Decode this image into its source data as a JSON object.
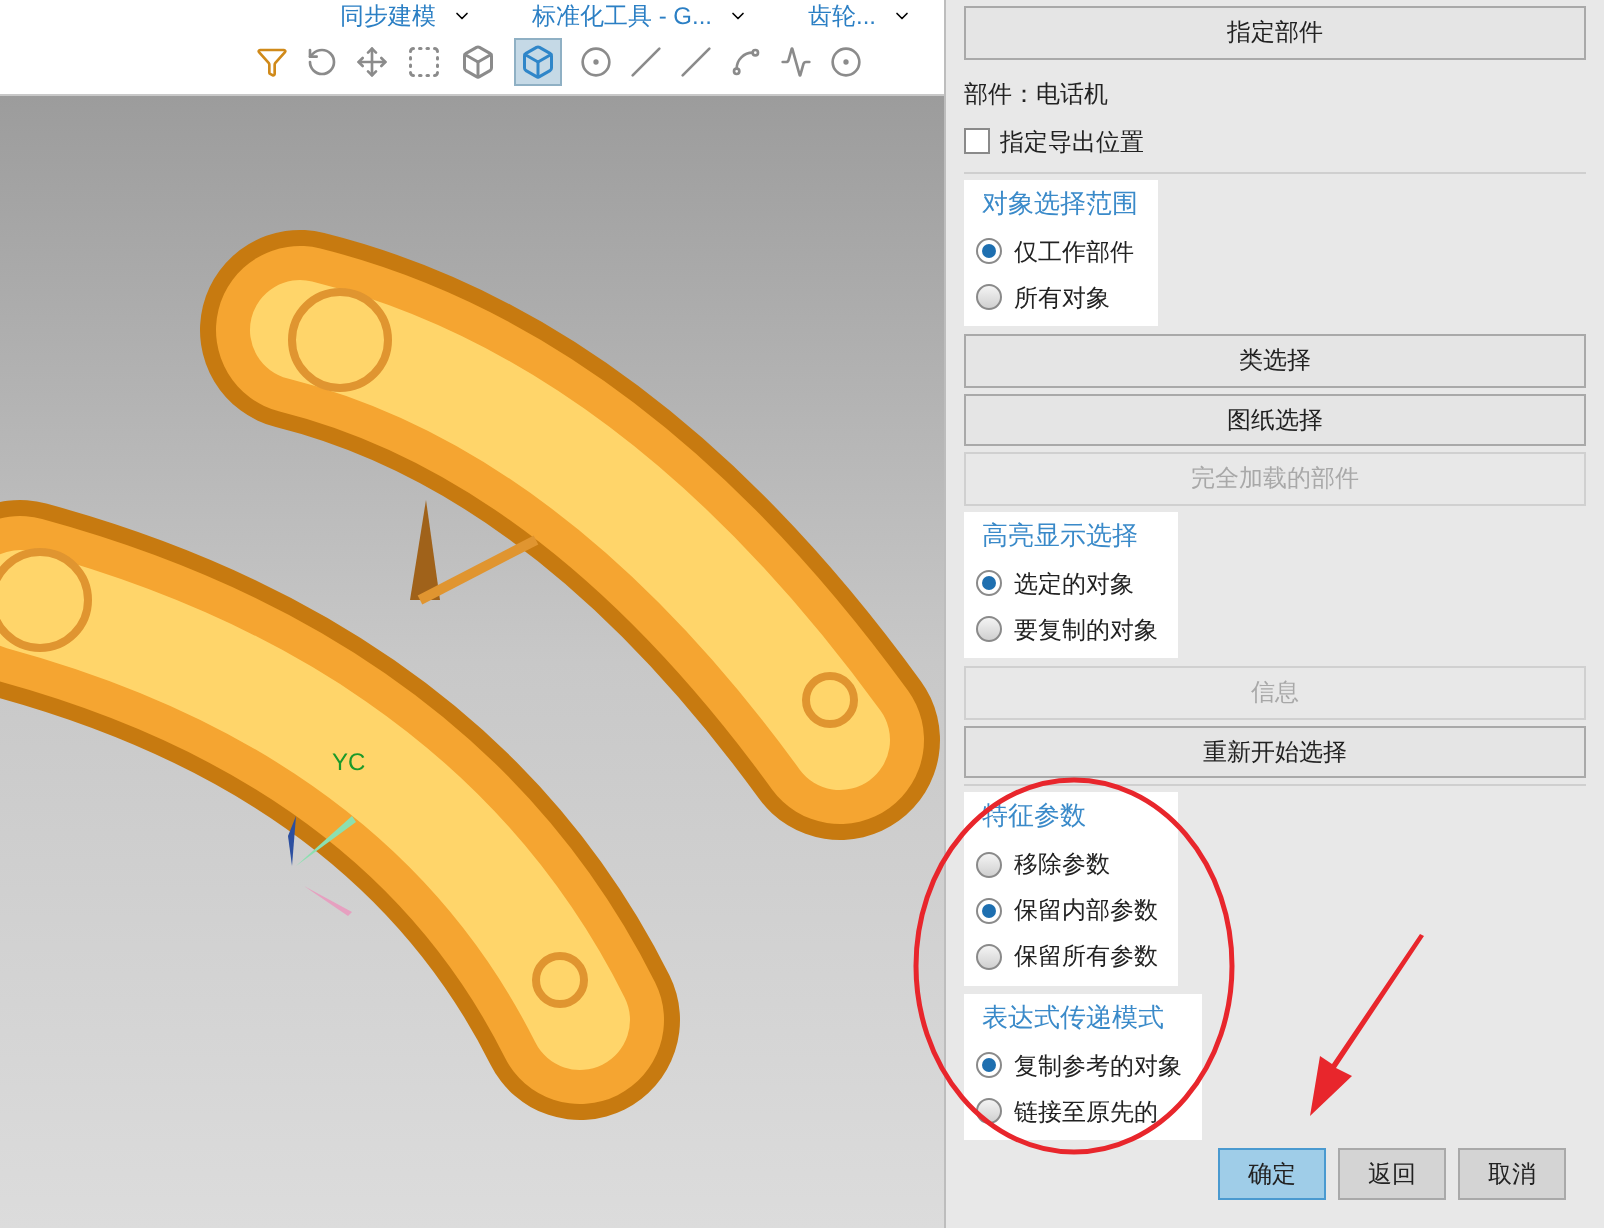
{
  "toolbar": {
    "menus": [
      {
        "label": "同步建模"
      },
      {
        "label": "标准化工具 - G..."
      },
      {
        "label": "齿轮..."
      }
    ]
  },
  "viewport": {
    "axis_label": "YC"
  },
  "dialog": {
    "sections": [
      {
        "kind": "button",
        "label": "指定部件",
        "disabled": false
      },
      {
        "kind": "text",
        "label": "部件：电话机"
      },
      {
        "kind": "checkbox",
        "label": "指定导出位置",
        "checked": false
      },
      {
        "kind": "radio_group",
        "title": "对象选择范围",
        "options": [
          {
            "label": "仅工作部件",
            "selected": true
          },
          {
            "label": "所有对象",
            "selected": false
          }
        ]
      },
      {
        "kind": "button",
        "label": "类选择",
        "disabled": false
      },
      {
        "kind": "button",
        "label": "图纸选择",
        "disabled": false
      },
      {
        "kind": "button",
        "label": "完全加载的部件",
        "disabled": true
      },
      {
        "kind": "radio_group",
        "title": "高亮显示选择",
        "options": [
          {
            "label": "选定的对象",
            "selected": true
          },
          {
            "label": "要复制的对象",
            "selected": false
          }
        ]
      },
      {
        "kind": "button",
        "label": "信息",
        "disabled": true
      },
      {
        "kind": "button",
        "label": "重新开始选择",
        "disabled": false
      },
      {
        "kind": "radio_group",
        "title": "特征参数",
        "options": [
          {
            "label": "移除参数",
            "selected": false
          },
          {
            "label": "保留内部参数",
            "selected": true
          },
          {
            "label": "保留所有参数",
            "selected": false
          }
        ]
      },
      {
        "kind": "radio_group",
        "title": "表达式传递模式",
        "options": [
          {
            "label": "复制参考的对象",
            "selected": true
          },
          {
            "label": "链接至原先的",
            "selected": false
          }
        ]
      }
    ],
    "footer": [
      {
        "label": "确定",
        "primary": true
      },
      {
        "label": "返回",
        "primary": false
      },
      {
        "label": "取消",
        "primary": false
      }
    ]
  }
}
